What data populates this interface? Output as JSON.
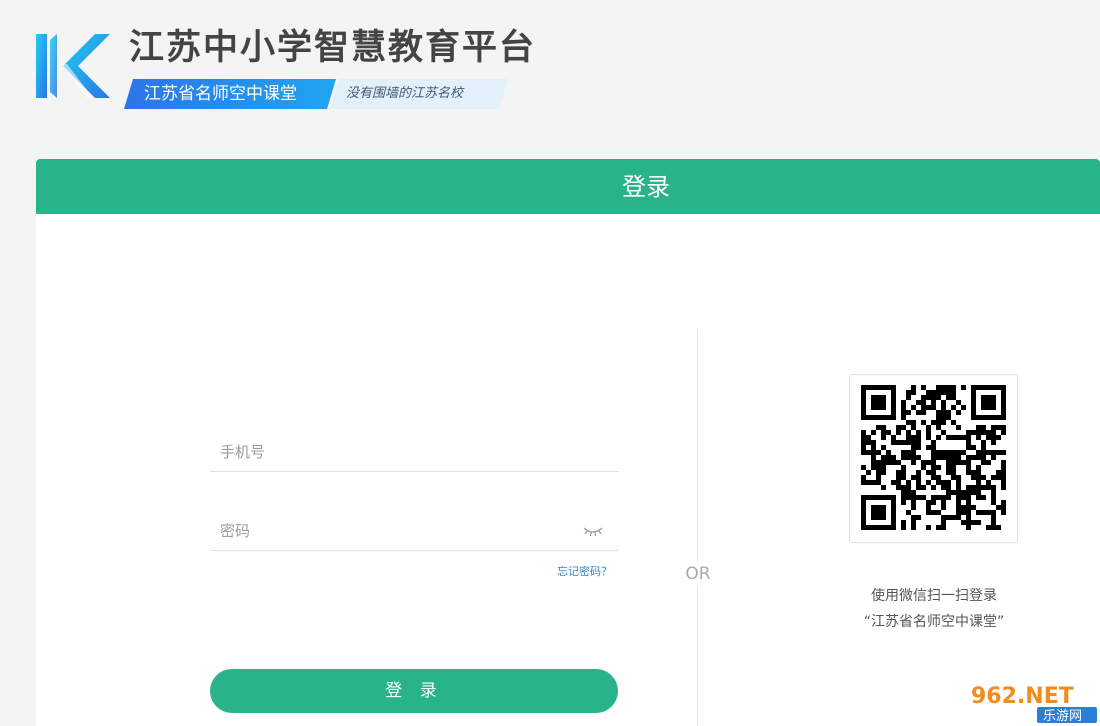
{
  "header": {
    "logo_icon": "k-logo-icon",
    "title": "江苏中小学智慧教育平台",
    "badge": "江苏省名师空中课堂",
    "slogan": "没有围墙的江苏名校"
  },
  "login": {
    "title": "登录",
    "phone_placeholder": "手机号",
    "password_placeholder": "密码",
    "password_icon": "eye-closed-icon",
    "forgot_link": "忘记密码？",
    "submit_label": "登 录",
    "divider_label": "OR"
  },
  "qr": {
    "icon": "qr-code-icon",
    "instruction": "使用微信扫一扫登录",
    "account": "“江苏省名师空中课堂”"
  },
  "watermark": {
    "text": "962.NET",
    "subtext": "乐游网"
  },
  "colors": {
    "primary_green": "#28b38a",
    "badge_blue": "#2d74e8",
    "logo_cyan": "#27b4ee",
    "link_blue": "#3b87c9"
  }
}
